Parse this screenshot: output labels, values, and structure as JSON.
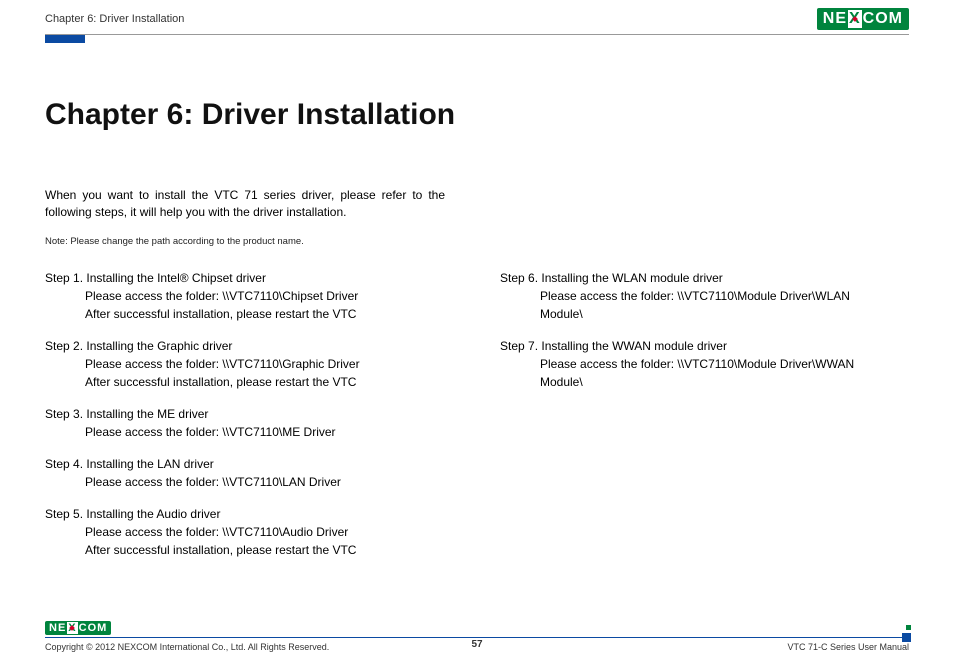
{
  "header": {
    "chapter_label": "Chapter 6: Driver Installation",
    "logo_text_1": "NE",
    "logo_text_x": "X",
    "logo_text_2": "COM"
  },
  "title": "Chapter 6: Driver Installation",
  "intro": "When you want to install the VTC 71 series driver, please refer to the following steps, it will help you with the driver installation.",
  "note": "Note: Please change the path according to the product name.",
  "steps_left": [
    {
      "title": "Step 1. Installing the Intel® Chipset driver",
      "lines": [
        "Please access the folder: \\\\VTC7110\\Chipset Driver",
        "After successful installation, please restart the VTC"
      ]
    },
    {
      "title": "Step 2. Installing the Graphic driver",
      "lines": [
        "Please access the folder: \\\\VTC7110\\Graphic Driver",
        "After successful installation, please restart the VTC"
      ]
    },
    {
      "title": "Step 3. Installing the ME driver",
      "lines": [
        "Please access the folder: \\\\VTC7110\\ME Driver"
      ]
    },
    {
      "title": "Step 4. Installing the LAN driver",
      "lines": [
        "Please access the folder: \\\\VTC7110\\LAN Driver"
      ]
    },
    {
      "title": "Step 5. Installing the Audio driver",
      "lines": [
        "Please access the folder: \\\\VTC7110\\Audio Driver",
        "After successful installation, please restart the VTC"
      ]
    }
  ],
  "steps_right": [
    {
      "title": "Step 6. Installing the WLAN module driver",
      "lines": [
        "Please access the folder: \\\\VTC7110\\Module Driver\\WLAN Module\\"
      ]
    },
    {
      "title": "Step 7. Installing the WWAN module driver",
      "lines": [
        "Please access the folder: \\\\VTC7110\\Module Driver\\WWAN Module\\"
      ]
    }
  ],
  "footer": {
    "copyright": "Copyright © 2012 NEXCOM International Co., Ltd. All Rights Reserved.",
    "page": "57",
    "manual": "VTC 71-C Series User Manual"
  }
}
